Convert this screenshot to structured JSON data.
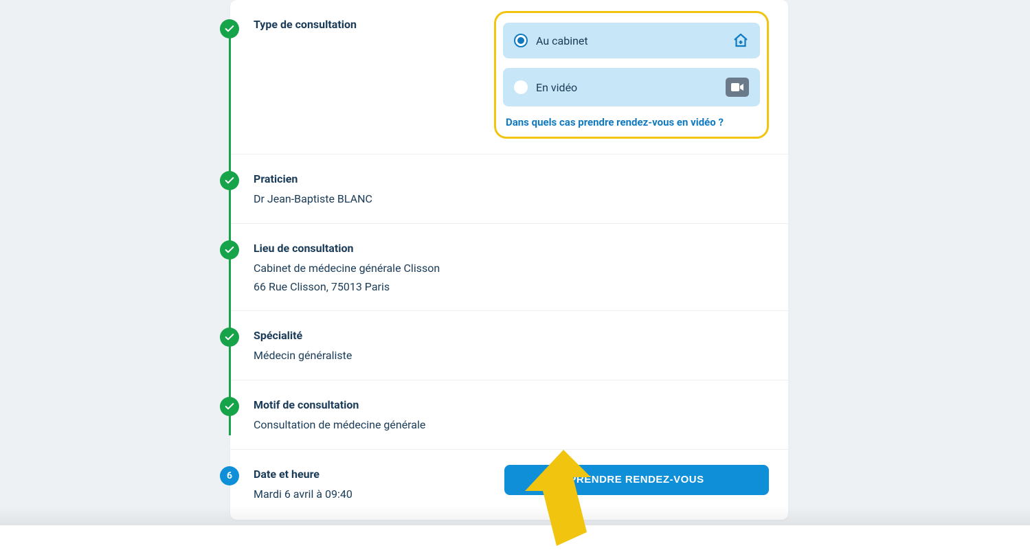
{
  "steps": {
    "type": {
      "title": "Type de consultation",
      "options": {
        "cabinet": "Au cabinet",
        "video": "En vidéo"
      },
      "selected": "cabinet",
      "help_link": "Dans quels cas prendre rendez-vous en vidéo ?"
    },
    "practitioner": {
      "title": "Praticien",
      "value": "Dr Jean-Baptiste BLANC"
    },
    "location": {
      "title": "Lieu de consultation",
      "line1": "Cabinet de médecine générale Clisson",
      "line2": "66 Rue Clisson, 75013 Paris"
    },
    "specialty": {
      "title": "Spécialité",
      "value": "Médecin généraliste"
    },
    "reason": {
      "title": "Motif de consultation",
      "value": "Consultation de médecine générale"
    },
    "datetime": {
      "number": "6",
      "title": "Date et heure",
      "value": "Mardi 6 avril à 09:40",
      "button": "PRENDRE RENDEZ-VOUS"
    }
  }
}
